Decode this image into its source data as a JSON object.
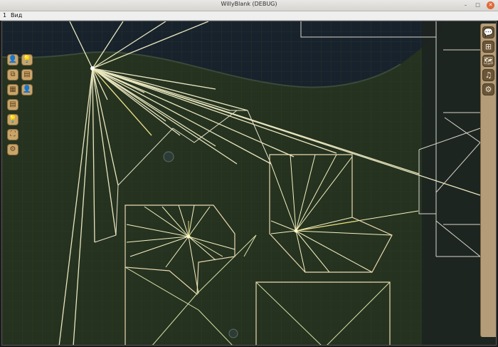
{
  "window": {
    "title": "WillyBlank (DEBUG)",
    "minimize_glyph": "–",
    "maximize_glyph": "□",
    "close_glyph": "✕"
  },
  "menu": {
    "items": [
      {
        "label": "1"
      },
      {
        "label": "Вид"
      }
    ]
  },
  "left_toolbar": {
    "buttons": [
      {
        "icon": "person-icon",
        "glyph": "👤"
      },
      {
        "icon": "lightbulb-icon",
        "glyph": "💡"
      },
      {
        "icon": "copy-icon",
        "glyph": "⧉"
      },
      {
        "icon": "vending-icon",
        "glyph": "▤"
      },
      {
        "icon": "grid-icon",
        "glyph": "▦"
      },
      {
        "icon": "person-icon",
        "glyph": "👤"
      },
      {
        "icon": "document-icon",
        "glyph": "▤"
      },
      {
        "icon": "lightbulb-icon",
        "glyph": "💡"
      },
      {
        "icon": "crop-icon",
        "glyph": "⛶"
      },
      {
        "icon": "gear-icon",
        "glyph": "⚙"
      }
    ]
  },
  "right_panel": {
    "buttons": [
      {
        "icon": "chat-icon",
        "glyph": "💬"
      },
      {
        "icon": "stairs-icon",
        "glyph": "⊞"
      },
      {
        "icon": "map-icon",
        "glyph": "🗺"
      },
      {
        "icon": "music-icon",
        "glyph": "♫"
      },
      {
        "icon": "settings-icon",
        "glyph": "⚙"
      }
    ]
  },
  "colors": {
    "ray": "#f4f0c8",
    "ray_yellow": "#e8dc70",
    "wall": "#d9d5cc",
    "room": "#ead8b0",
    "water": "#17222c",
    "ground": "#25321f",
    "toolbar_button": "#c9a56a",
    "panel": "#b49c78"
  }
}
